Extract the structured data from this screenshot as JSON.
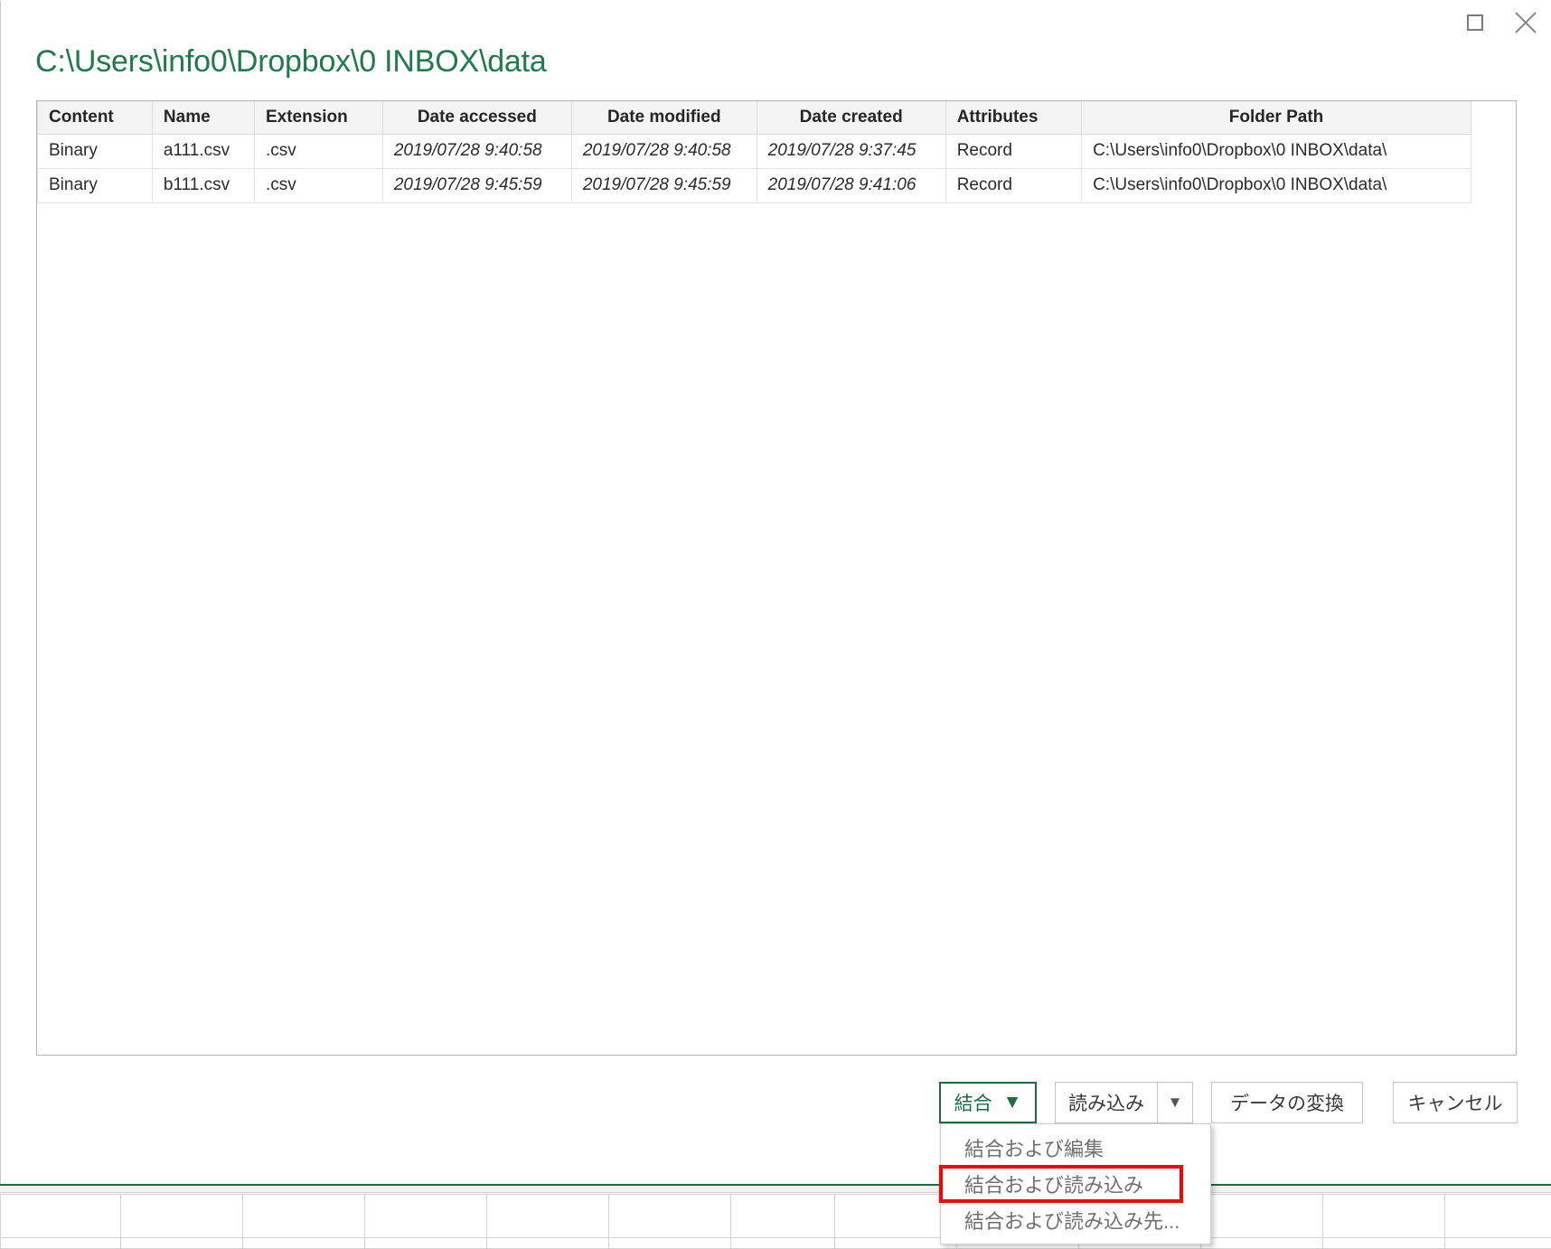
{
  "window": {
    "maximize_label": "Maximize",
    "close_label": "Close"
  },
  "dialog": {
    "title": "C:\\Users\\info0\\Dropbox\\0 INBOX\\data",
    "accent_color": "#217a4b"
  },
  "table": {
    "columns": [
      {
        "label": "Content",
        "align": "left"
      },
      {
        "label": "Name",
        "align": "left"
      },
      {
        "label": "Extension",
        "align": "left"
      },
      {
        "label": "Date accessed",
        "align": "center"
      },
      {
        "label": "Date modified",
        "align": "center"
      },
      {
        "label": "Date created",
        "align": "center"
      },
      {
        "label": "Attributes",
        "align": "left"
      },
      {
        "label": "Folder Path",
        "align": "center"
      }
    ],
    "rows": [
      {
        "content": "Binary",
        "name": "a111.csv",
        "extension": ".csv",
        "date_accessed": "2019/07/28 9:40:58",
        "date_modified": "2019/07/28 9:40:58",
        "date_created": "2019/07/28 9:37:45",
        "attributes": "Record",
        "folder_path": "C:\\Users\\info0\\Dropbox\\0 INBOX\\data\\"
      },
      {
        "content": "Binary",
        "name": "b111.csv",
        "extension": ".csv",
        "date_accessed": "2019/07/28 9:45:59",
        "date_modified": "2019/07/28 9:45:59",
        "date_created": "2019/07/28 9:41:06",
        "attributes": "Record",
        "folder_path": "C:\\Users\\info0\\Dropbox\\0 INBOX\\data\\"
      }
    ]
  },
  "buttons": {
    "combine": "結合",
    "combine_caret": "▼",
    "load": "読み込み",
    "load_caret": "▼",
    "transform": "データの変換",
    "cancel": "キャンセル"
  },
  "combine_menu": {
    "items": [
      {
        "label": "結合および編集",
        "highlighted": false
      },
      {
        "label": "結合および読み込み",
        "highlighted": true
      },
      {
        "label": "結合および読み込み先...",
        "highlighted": false
      }
    ],
    "highlight_color": "#ff0000"
  }
}
